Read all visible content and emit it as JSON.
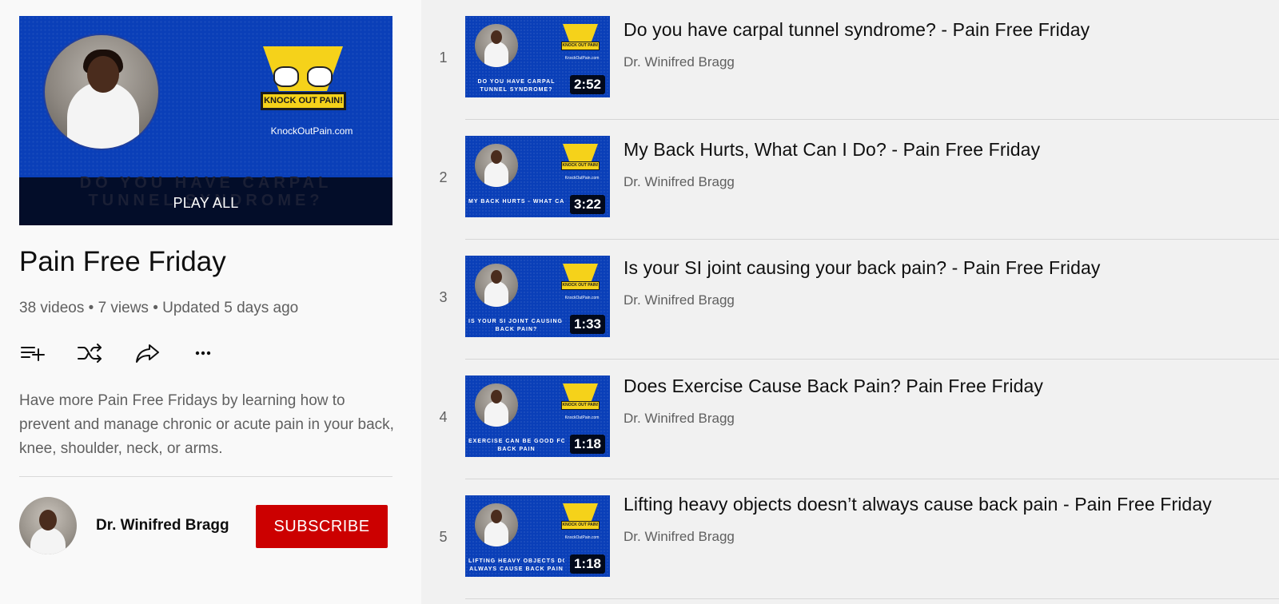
{
  "playlist": {
    "hero": {
      "play_all": "PLAY ALL",
      "logo_text": "KNOCK OUT PAIN!",
      "site": "KnockOutPain.com",
      "caption_lines": [
        "DO YOU HAVE CARPAL",
        "TUNNEL SYNDROME?"
      ]
    },
    "title": "Pain Free Friday",
    "meta": {
      "videos": "38 videos",
      "views": "7 views",
      "updated": "Updated 5 days ago",
      "separator": " • "
    },
    "actions": [
      {
        "icon": "add-to-queue-icon"
      },
      {
        "icon": "shuffle-icon"
      },
      {
        "icon": "share-icon"
      },
      {
        "icon": "more-icon"
      }
    ],
    "description": "Have more Pain Free Fridays by learning how to prevent and manage chronic or acute pain in your back, knee, shoulder, neck, or arms.",
    "channel": {
      "name": "Dr. Winifred Bragg",
      "subscribe_label": "SUBSCRIBE"
    }
  },
  "videos": [
    {
      "index": "1",
      "title": "Do you have carpal tunnel syndrome? - Pain Free Friday",
      "channel": "Dr. Winifred Bragg",
      "duration": "2:52",
      "thumb_caption": [
        "DO YOU HAVE CARPAL",
        "TUNNEL SYNDROME?"
      ]
    },
    {
      "index": "2",
      "title": "My Back Hurts, What Can I Do? - Pain Free Friday",
      "channel": "Dr. Winifred Bragg",
      "duration": "3:22",
      "thumb_caption": [
        "MY BACK HURTS - WHAT CAN I DO?",
        ""
      ]
    },
    {
      "index": "3",
      "title": "Is your SI joint causing your back pain? - Pain Free Friday",
      "channel": "Dr. Winifred Bragg",
      "duration": "1:33",
      "thumb_caption": [
        "IS YOUR SI JOINT CAUSING YOUR",
        "BACK PAIN?"
      ]
    },
    {
      "index": "4",
      "title": "Does Exercise Cause Back Pain? Pain Free Friday",
      "channel": "Dr. Winifred Bragg",
      "duration": "1:18",
      "thumb_caption": [
        "EXERCISE CAN BE GOOD FOR",
        "BACK PAIN"
      ]
    },
    {
      "index": "5",
      "title": "Lifting heavy objects doesn’t always cause back pain - Pain Free Friday",
      "channel": "Dr. Winifred Bragg",
      "duration": "1:18",
      "thumb_caption": [
        "LIFTING HEAVY OBJECTS DOESN'T",
        "ALWAYS CAUSE BACK PAIN"
      ]
    }
  ],
  "colors": {
    "subscribe": "#cc0000",
    "thumb_blue": "#0a3fb8",
    "logo_yellow": "#f5d21a"
  }
}
